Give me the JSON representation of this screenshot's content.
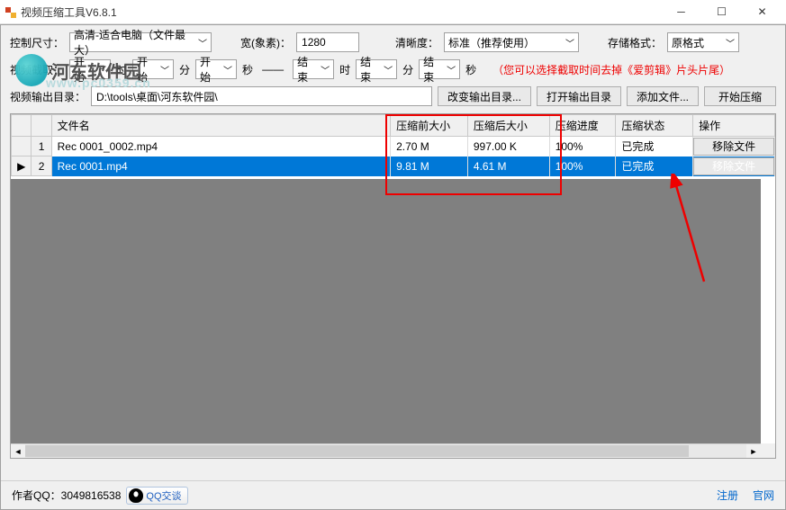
{
  "window": {
    "title": "视频压缩工具V6.8.1"
  },
  "toolbar1": {
    "size_label": "控制尺寸：",
    "size_value": "高清-适合电脑（文件最大）",
    "width_label": "宽(象素)：",
    "width_value": "1280",
    "clarity_label": "清晰度：",
    "clarity_value": "标准（推荐使用）",
    "format_label": "存储格式：",
    "format_value": "原格式"
  },
  "toolbar2": {
    "crop_label": "视频截取：",
    "start": "开始",
    "end": "结束",
    "hour": "时",
    "min": "分",
    "sec": "秒",
    "hint_prefix": "（您可以选择截取时间去掉《",
    "hint_app": "爱剪辑",
    "hint_suffix": "》片头片尾）"
  },
  "toolbar3": {
    "outdir_label": "视频输出目录：",
    "outdir_value": "D:\\tools\\桌面\\河东软件园\\",
    "change_dir": "改变输出目录...",
    "open_dir": "打开输出目录",
    "add_file": "添加文件...",
    "start_compress": "开始压缩"
  },
  "table": {
    "headers": {
      "name": "文件名",
      "before": "压缩前大小",
      "after": "压缩后大小",
      "progress": "压缩进度",
      "status": "压缩状态",
      "action": "操作"
    },
    "rows": [
      {
        "idx": "1",
        "name": "Rec 0001_0002.mp4",
        "before": "2.70 M",
        "after": "997.00 K",
        "progress": "100%",
        "status": "已完成",
        "action": "移除文件",
        "selected": false,
        "pointer": ""
      },
      {
        "idx": "2",
        "name": "Rec 0001.mp4",
        "before": "9.81 M",
        "after": "4.61 M",
        "progress": "100%",
        "status": "已完成",
        "action": "移除文件",
        "selected": true,
        "pointer": "▶"
      }
    ]
  },
  "footer": {
    "author": "作者QQ：3049816538",
    "qq_chat": "QQ交谈",
    "register": "注册",
    "website": "官网"
  },
  "watermark": {
    "site": "河东软件园",
    "url": "www.pc0359.cn"
  }
}
